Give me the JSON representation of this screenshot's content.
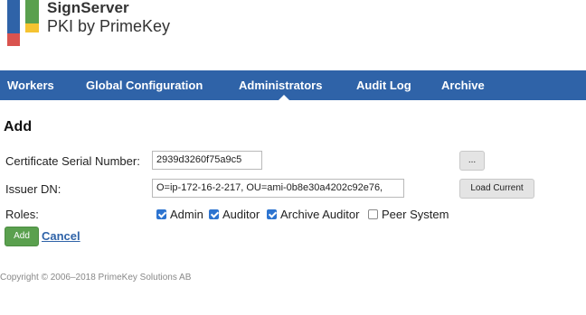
{
  "brand": {
    "name": "SignServer",
    "subtitle": "PKI by PrimeKey"
  },
  "logo_colors": {
    "blue": "#2f63a8",
    "green": "#5aa04e",
    "yellow": "#f5c331",
    "red": "#d9534f"
  },
  "nav": {
    "items": [
      {
        "label": "Workers"
      },
      {
        "label": "Global Configuration"
      },
      {
        "label": "Administrators",
        "active": true
      },
      {
        "label": "Audit Log"
      },
      {
        "label": "Archive"
      }
    ]
  },
  "page": {
    "title": "Add"
  },
  "form": {
    "serial_label": "Certificate Serial Number:",
    "serial_value": "2939d3260f75a9c5",
    "browse_label": "...",
    "issuer_label": "Issuer DN:",
    "issuer_value": "O=ip-172-16-2-217, OU=ami-0b8e30a4202c92e76,",
    "load_current_label": "Load Current",
    "roles_label": "Roles:",
    "roles": [
      {
        "label": "Admin",
        "checked": true
      },
      {
        "label": "Auditor",
        "checked": true
      },
      {
        "label": "Archive Auditor",
        "checked": true
      },
      {
        "label": "Peer System",
        "checked": false
      }
    ],
    "add_label": "Add",
    "cancel_label": "Cancel"
  },
  "footer": {
    "text": "Copyright © 2006–2018 PrimeKey Solutions AB"
  }
}
